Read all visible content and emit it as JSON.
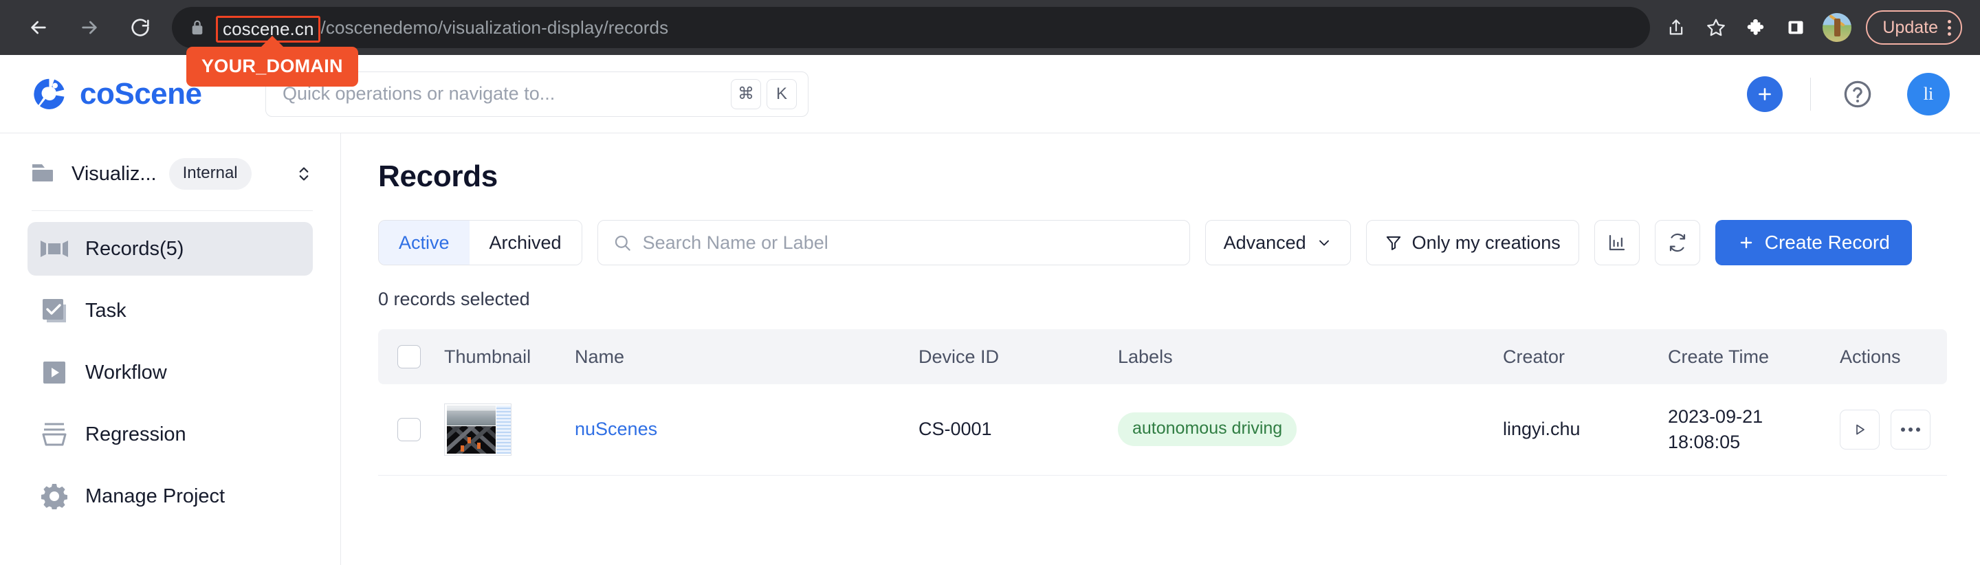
{
  "browser": {
    "back_icon": "arrow-left-icon",
    "forward_icon": "arrow-right-icon",
    "reload_icon": "reload-icon",
    "lock_icon": "lock-icon",
    "url_host": "coscene.cn",
    "url_path": "/coscenedemo/visualization-display/records",
    "share_icon": "share-icon",
    "bookmark_icon": "star-icon",
    "extensions_icon": "puzzle-icon",
    "sidepanel_icon": "side-panel-icon",
    "profile_icon": "profile-avatar",
    "update_label": "Update",
    "menu_icon": "kebab-menu-icon"
  },
  "header": {
    "brand": "coScene",
    "logo_icon": "coscene-logo-icon",
    "callout": "YOUR_DOMAIN",
    "search": {
      "placeholder": "Quick operations or navigate to...",
      "kbd_modifier": "⌘",
      "kbd_key": "K"
    },
    "add_label": "+",
    "help_icon": "question-circle-icon",
    "avatar_initials": "li"
  },
  "sidebar": {
    "project": {
      "folder_icon": "folder-icon",
      "name": "Visualiz...",
      "badge": "Internal",
      "chevrons_icon": "chevron-up-down-icon"
    },
    "items": [
      {
        "label": "Records(5)",
        "icon": "film-icon",
        "active": true
      },
      {
        "label": "Task",
        "icon": "checkbox-stack-icon",
        "active": false
      },
      {
        "label": "Workflow",
        "icon": "play-square-icon",
        "active": false
      },
      {
        "label": "Regression",
        "icon": "layers-icon",
        "active": false
      },
      {
        "label": "Manage Project",
        "icon": "gear-icon",
        "active": false
      }
    ]
  },
  "main": {
    "title": "Records",
    "tabs": [
      {
        "label": "Active",
        "active": true
      },
      {
        "label": "Archived",
        "active": false
      }
    ],
    "search_placeholder": "Search Name or Label",
    "search_icon": "search-icon",
    "advanced_label": "Advanced",
    "advanced_icon": "chevron-down-icon",
    "only_mine_label": "Only my creations",
    "only_mine_icon": "filter-icon",
    "chart_icon": "bar-chart-icon",
    "refresh_icon": "refresh-icon",
    "create_label": "Create Record",
    "create_icon": "plus-icon",
    "selection_text": "0 records selected",
    "table": {
      "columns": [
        "Thumbnail",
        "Name",
        "Device ID",
        "Labels",
        "Creator",
        "Create Time",
        "Actions"
      ],
      "rows": [
        {
          "thumbnail": "record-thumbnail",
          "name": "nuScenes",
          "device_id": "CS-0001",
          "label": "autonomous driving",
          "creator": "lingyi.chu",
          "create_date": "2023-09-21",
          "create_time": "18:08:05",
          "play_icon": "play-icon",
          "more_icon": "more-horizontal-icon"
        }
      ]
    }
  },
  "colors": {
    "accent": "#2f6fe4",
    "callout": "#f0512a",
    "tag_bg": "#e3f8e8",
    "tag_fg": "#2f7d42",
    "chrome_bg": "#35363a",
    "omnibox_bg": "#202124"
  }
}
